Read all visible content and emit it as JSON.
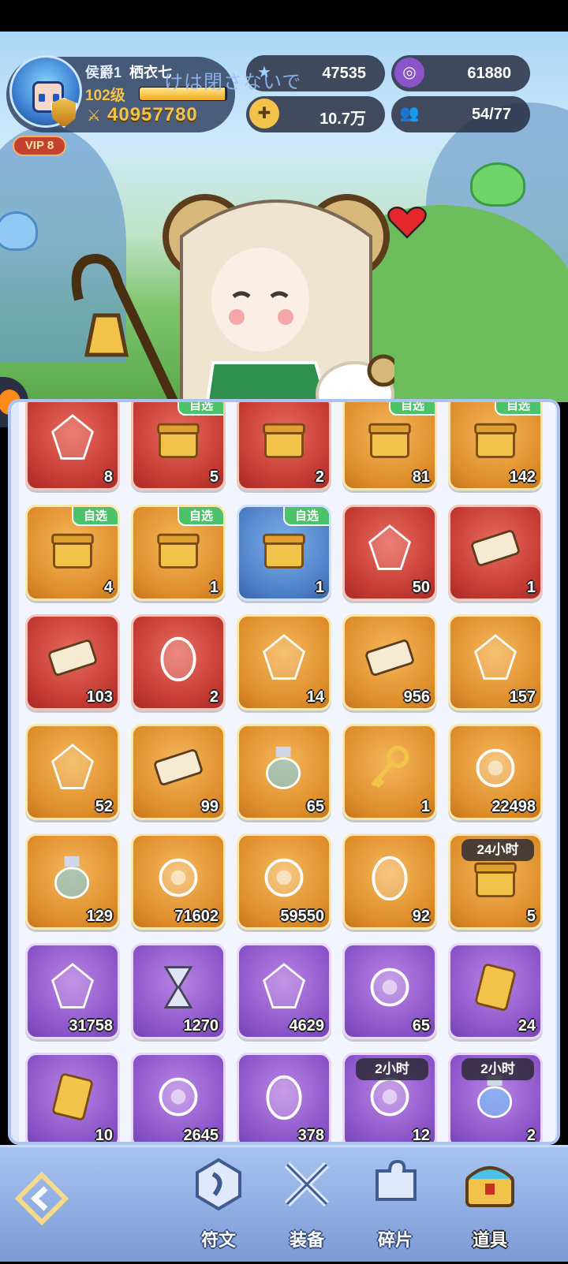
{
  "player": {
    "rank": "侯爵1",
    "name": "栖衣七",
    "level": "102级",
    "xp_fraction": 0.98,
    "power": "40957780",
    "vip": "VIP 8"
  },
  "overlay_text": "けは閉さないで",
  "currencies": {
    "gems": "47535",
    "purple_coin": "61880",
    "gold": "10.7万",
    "members": "54/77"
  },
  "inventory": [
    {
      "color": "red",
      "icon": "red-crystal-icon",
      "count": "8"
    },
    {
      "color": "red",
      "icon": "fire-gem-pack-icon",
      "count": "5",
      "tag": "自选"
    },
    {
      "color": "red",
      "icon": "mystery-chest-icon",
      "count": "2"
    },
    {
      "color": "gold",
      "icon": "star-gift-box-icon",
      "count": "81",
      "tag": "自选"
    },
    {
      "color": "gold",
      "icon": "star-gift-box-icon",
      "count": "142",
      "tag": "自选"
    },
    {
      "color": "gold",
      "icon": "treasure-chest-icon",
      "count": "4",
      "tag": "自选"
    },
    {
      "color": "gold",
      "icon": "gem-chest-icon",
      "count": "1",
      "tag": "自选"
    },
    {
      "color": "blue",
      "icon": "blue-orb-chest-icon",
      "count": "1",
      "tag": "自选"
    },
    {
      "color": "red",
      "icon": "lotus-crystal-icon",
      "count": "50"
    },
    {
      "color": "red",
      "icon": "blue-ticket-icon",
      "count": "1"
    },
    {
      "color": "red",
      "icon": "summon-ticket-icon",
      "count": "103"
    },
    {
      "color": "red",
      "icon": "fire-egg-icon",
      "count": "2"
    },
    {
      "color": "gold",
      "icon": "gold-crystal-icon",
      "count": "14"
    },
    {
      "color": "gold",
      "icon": "gold-ticket-icon",
      "count": "956"
    },
    {
      "color": "gold",
      "icon": "star-crystal-icon",
      "count": "157"
    },
    {
      "color": "gold",
      "icon": "green-leaf-gem-icon",
      "count": "52"
    },
    {
      "color": "gold",
      "icon": "heart-ticket-icon",
      "count": "99"
    },
    {
      "color": "gold",
      "icon": "potion-vial-icon",
      "count": "65"
    },
    {
      "color": "gold",
      "icon": "golden-key-icon",
      "count": "1"
    },
    {
      "color": "gold",
      "icon": "silver-coin-icon",
      "count": "22498"
    },
    {
      "color": "gold",
      "icon": "lightning-potion-icon",
      "count": "129"
    },
    {
      "color": "gold",
      "icon": "gold-coin-icon",
      "count": "71602"
    },
    {
      "color": "gold",
      "icon": "purple-coin-icon",
      "count": "59550"
    },
    {
      "color": "gold",
      "icon": "dragon-egg-icon",
      "count": "92"
    },
    {
      "color": "gold",
      "icon": "gold-chest-icon",
      "count": "5",
      "timer": "24小时"
    },
    {
      "color": "purple",
      "icon": "diamond-frame-icon",
      "count": "31758"
    },
    {
      "color": "purple",
      "icon": "hourglass-icon",
      "count": "1270"
    },
    {
      "color": "purple",
      "icon": "crystal-cluster-icon",
      "count": "4629"
    },
    {
      "color": "purple",
      "icon": "cosmic-orb-icon",
      "count": "65"
    },
    {
      "color": "purple",
      "icon": "sword-card-icon",
      "count": "24"
    },
    {
      "color": "purple",
      "icon": "refresh-card-icon",
      "count": "10"
    },
    {
      "color": "purple",
      "icon": "planet-orb-icon",
      "count": "2645"
    },
    {
      "color": "purple",
      "icon": "purple-egg-icon",
      "count": "378"
    },
    {
      "color": "purple",
      "icon": "coin-stack-icon",
      "count": "12",
      "timer": "2小时"
    },
    {
      "color": "purple",
      "icon": "green-potion-icon",
      "count": "2",
      "timer": "2小时"
    }
  ],
  "nav": [
    {
      "label": "符文",
      "icon": "rune-icon"
    },
    {
      "label": "装备",
      "icon": "crossed-swords-icon"
    },
    {
      "label": "碎片",
      "icon": "puzzle-piece-icon"
    },
    {
      "label": "道具",
      "icon": "treasure-chest-icon",
      "active": true
    }
  ],
  "colors": {
    "red": "#c43a33",
    "gold": "#df8e2b",
    "blue": "#4d7fc7",
    "purple": "#8b55c9",
    "tag_green": "#4cc36a"
  }
}
